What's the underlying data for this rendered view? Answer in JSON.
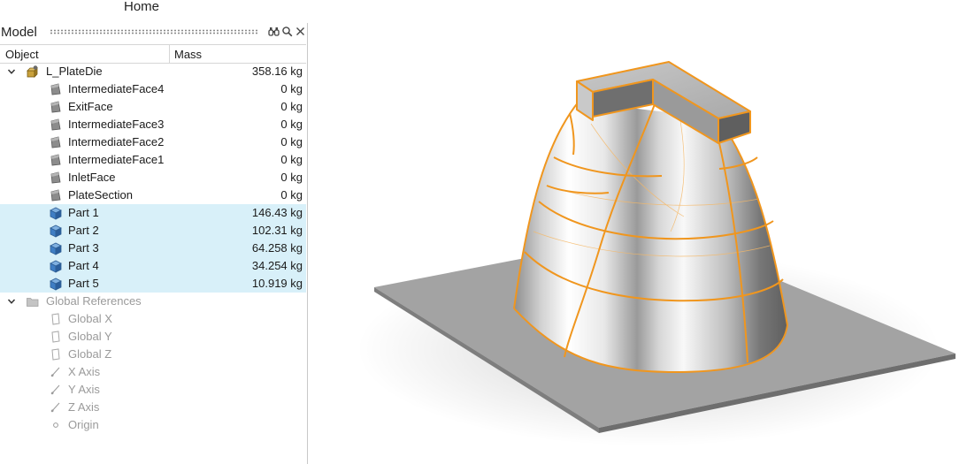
{
  "ribbon": {
    "tab_label": "Home"
  },
  "browser": {
    "title": "Model",
    "icons": [
      "binoculars-icon",
      "search-icon",
      "close-icon"
    ],
    "columns": {
      "object": "Object",
      "mass": "Mass"
    },
    "root": {
      "label": "L_PlateDie",
      "mass": "358.16 kg",
      "expanded": true
    },
    "faces": [
      {
        "label": "IntermediateFace4",
        "mass": "0 kg"
      },
      {
        "label": "ExitFace",
        "mass": "0 kg"
      },
      {
        "label": "IntermediateFace3",
        "mass": "0 kg"
      },
      {
        "label": "IntermediateFace2",
        "mass": "0 kg"
      },
      {
        "label": "IntermediateFace1",
        "mass": "0 kg"
      },
      {
        "label": "InletFace",
        "mass": "0 kg"
      },
      {
        "label": "PlateSection",
        "mass": "0 kg"
      }
    ],
    "parts": [
      {
        "label": "Part 1",
        "mass": "146.43 kg",
        "selected": true
      },
      {
        "label": "Part 2",
        "mass": "102.31 kg",
        "selected": true
      },
      {
        "label": "Part 3",
        "mass": "64.258 kg",
        "selected": true
      },
      {
        "label": "Part 4",
        "mass": "34.254 kg",
        "selected": true
      },
      {
        "label": "Part 5",
        "mass": "10.919 kg",
        "selected": true
      }
    ],
    "global_references": {
      "label": "Global References",
      "expanded": true,
      "items": [
        {
          "label": "Global X",
          "icon": "plane-icon"
        },
        {
          "label": "Global Y",
          "icon": "plane-icon"
        },
        {
          "label": "Global Z",
          "icon": "plane-icon"
        },
        {
          "label": "X Axis",
          "icon": "axis-icon"
        },
        {
          "label": "Y Axis",
          "icon": "axis-icon"
        },
        {
          "label": "Z Axis",
          "icon": "axis-icon"
        },
        {
          "label": "Origin",
          "icon": "origin-icon"
        }
      ]
    }
  },
  "viewport": {
    "highlight_color": "#f0961e",
    "plate_color": "#9c9c9c"
  }
}
